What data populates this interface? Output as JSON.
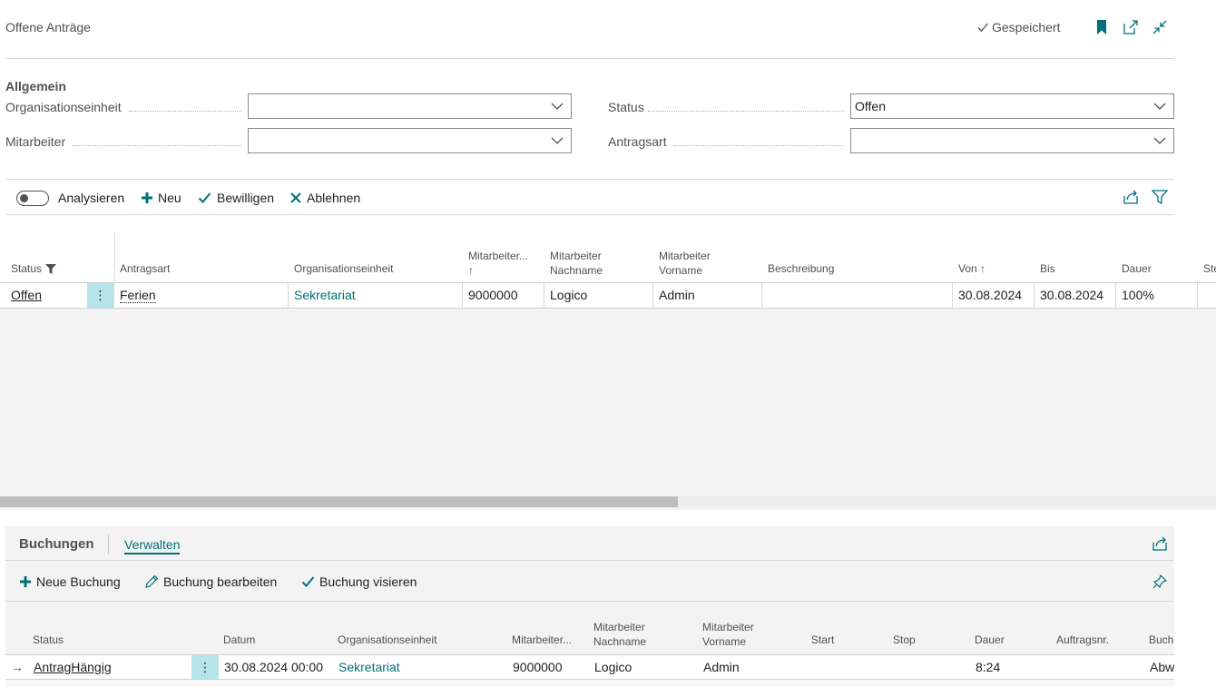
{
  "header": {
    "title": "Offene Anträge",
    "saved_label": "Gespeichert"
  },
  "general": {
    "section_title": "Allgemein",
    "fields": {
      "org_label": "Organisationseinheit",
      "org_value": "",
      "emp_label": "Mitarbeiter",
      "emp_value": "",
      "status_label": "Status",
      "status_value": "Offen",
      "type_label": "Antragsart",
      "type_value": ""
    }
  },
  "toolbar": {
    "analyze": "Analysieren",
    "new": "Neu",
    "approve": "Bewilligen",
    "reject": "Ablehnen"
  },
  "list": {
    "columns": {
      "status": "Status",
      "antragsart": "Antragsart",
      "orgeinheit": "Organisationseinheit",
      "mitarbeiter_l1": "Mitarbeiter...",
      "mitarbeiter_l2": "↑",
      "nachname_l1": "Mitarbeiter",
      "nachname_l2": "Nachname",
      "vorname_l1": "Mitarbeiter",
      "vorname_l2": "Vorname",
      "beschreibung": "Beschreibung",
      "von": "Von ↑",
      "bis": "Bis",
      "dauer": "Dauer",
      "cut": "Ste"
    },
    "rows": [
      {
        "status": "Offen",
        "menu": "⋮",
        "antragsart": "Ferien",
        "orgeinheit": "Sekretariat",
        "mitarbeiter": "9000000",
        "nachname": "Logico",
        "vorname": "Admin",
        "beschreibung": "",
        "von": "30.08.2024",
        "bis": "30.08.2024",
        "dauer": "100%"
      }
    ]
  },
  "bookings": {
    "tab_title": "Buchungen",
    "tab_manage": "Verwalten",
    "toolbar": {
      "new": "Neue Buchung",
      "edit": "Buchung bearbeiten",
      "approve": "Buchung visieren"
    },
    "columns": {
      "status": "Status",
      "datum": "Datum",
      "orgeinheit": "Organisationseinheit",
      "mitarbeiter": "Mitarbeiter...",
      "nachname_l1": "Mitarbeiter",
      "nachname_l2": "Nachname",
      "vorname_l1": "Mitarbeiter",
      "vorname_l2": "Vorname",
      "start": "Start",
      "stop": "Stop",
      "dauer": "Dauer",
      "auftragsnr": "Auftragsnr.",
      "cut": "Buchu"
    },
    "rows": [
      {
        "arrow": "→",
        "status": "AntragHängig",
        "menu": "⋮",
        "datum": "30.08.2024 00:00",
        "orgeinheit": "Sekretariat",
        "mitarbeiter": "9000000",
        "nachname": "Logico",
        "vorname": "Admin",
        "start": "",
        "stop": "",
        "dauer": "8:24",
        "auftragsnr": "",
        "cut": "Abw"
      }
    ]
  },
  "colors": {
    "accent": "#00707a",
    "selection": "#b7e4e8"
  }
}
